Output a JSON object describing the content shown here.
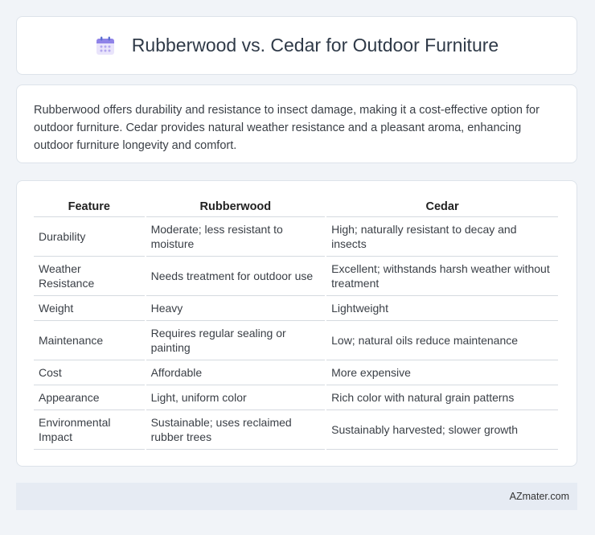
{
  "header": {
    "icon": "calendar-icon",
    "title": "Rubberwood vs. Cedar for Outdoor Furniture"
  },
  "description": "Rubberwood offers durability and resistance to insect damage, making it a cost-effective option for outdoor furniture. Cedar provides natural weather resistance and a pleasant aroma, enhancing outdoor furniture longevity and comfort.",
  "table": {
    "headers": [
      "Feature",
      "Rubberwood",
      "Cedar"
    ],
    "rows": [
      [
        "Durability",
        "Moderate; less resistant to moisture",
        "High; naturally resistant to decay and insects"
      ],
      [
        "Weather Resistance",
        "Needs treatment for outdoor use",
        "Excellent; withstands harsh weather without treatment"
      ],
      [
        "Weight",
        "Heavy",
        "Lightweight"
      ],
      [
        "Maintenance",
        "Requires regular sealing or painting",
        "Low; natural oils reduce maintenance"
      ],
      [
        "Cost",
        "Affordable",
        "More expensive"
      ],
      [
        "Appearance",
        "Light, uniform color",
        "Rich color with natural grain patterns"
      ],
      [
        "Environmental Impact",
        "Sustainable; uses reclaimed rubber trees",
        "Sustainably harvested; slower growth"
      ]
    ]
  },
  "footer": {
    "brand": "AZmater.com"
  }
}
